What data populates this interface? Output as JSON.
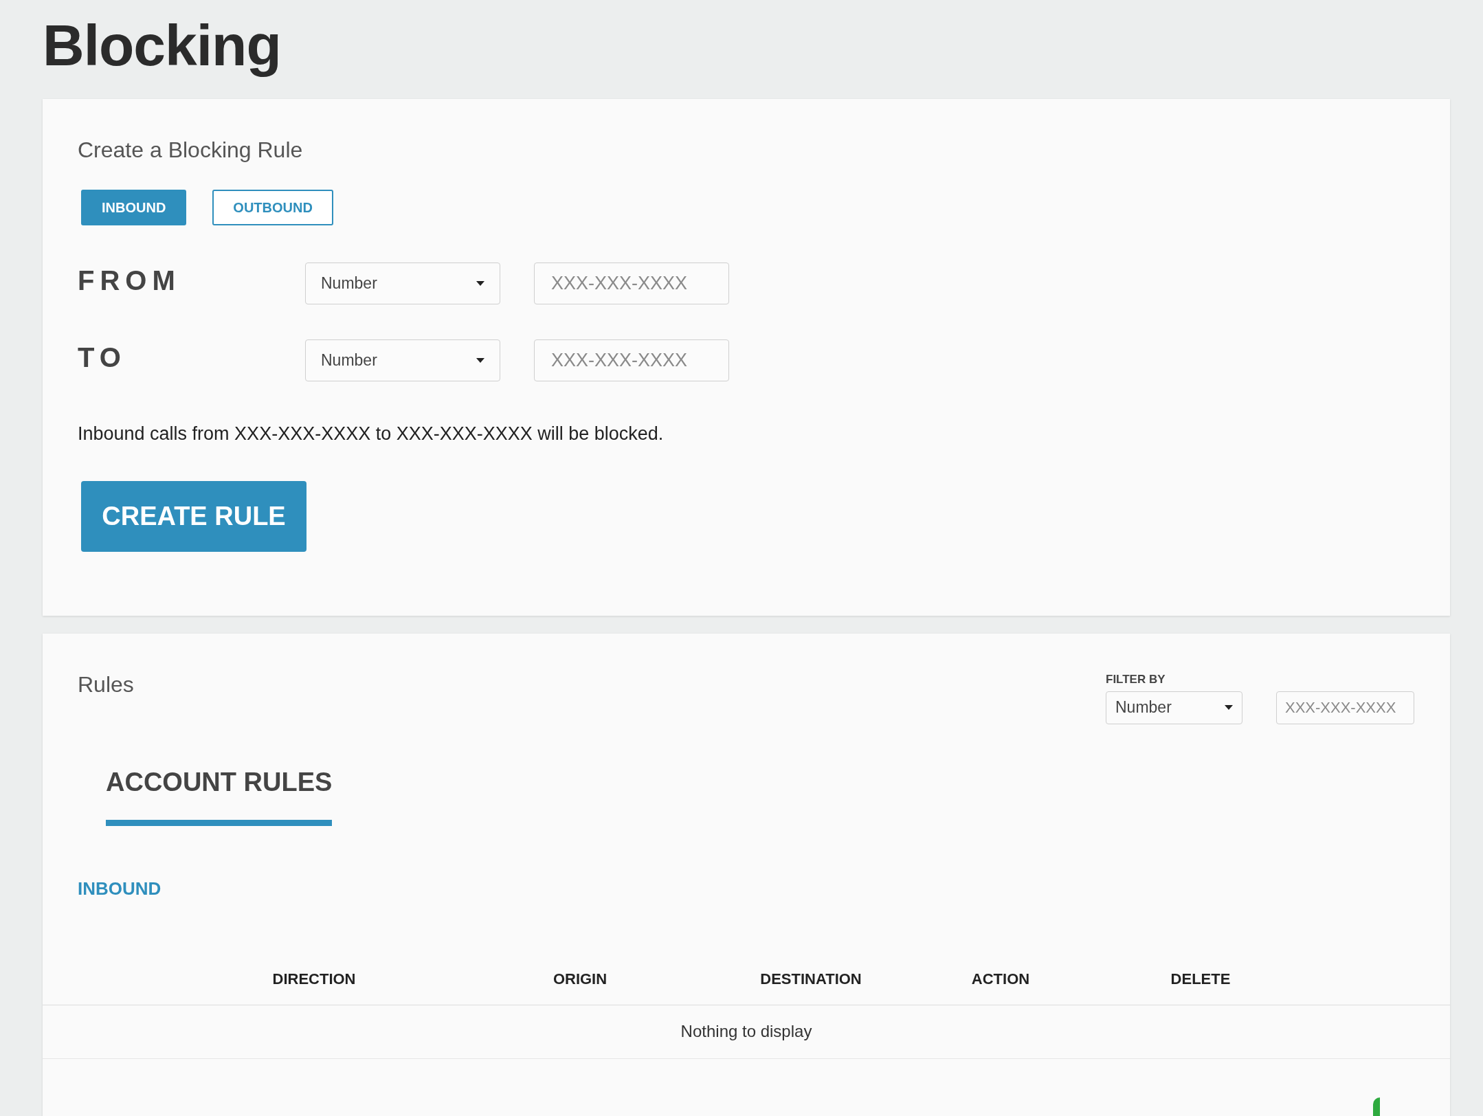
{
  "page_title": "Blocking",
  "create_rule": {
    "title": "Create a Blocking Rule",
    "direction_tabs": [
      {
        "label": "INBOUND",
        "selected": true
      },
      {
        "label": "OUTBOUND",
        "selected": false
      }
    ],
    "rows": [
      {
        "label": "FROM",
        "select": "Number",
        "placeholder": "XXX-XXX-XXXX"
      },
      {
        "label": "TO",
        "select": "Number",
        "placeholder": "XXX-XXX-XXXX"
      }
    ],
    "summary": "Inbound calls from XXX-XXX-XXXX to XXX-XXX-XXXX will be blocked.",
    "button": "CREATE RULE"
  },
  "rules": {
    "title": "Rules",
    "filter_label": "FILTER BY",
    "filter_select": "Number",
    "filter_placeholder": "XXX-XXX-XXXX",
    "tabs": [
      {
        "label": "ACCOUNT RULES",
        "selected": true
      }
    ],
    "section": "INBOUND",
    "table": {
      "columns": [
        "DIRECTION",
        "ORIGIN",
        "DESTINATION",
        "ACTION",
        "DELETE"
      ],
      "empty": "Nothing to display"
    }
  }
}
